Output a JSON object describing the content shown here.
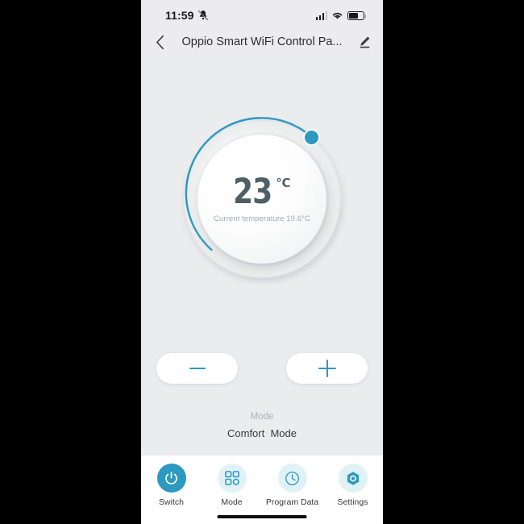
{
  "status_bar": {
    "time": "11:59",
    "mute_icon": "bell-slash-icon",
    "signal_icon": "cellular-signal-icon",
    "wifi_icon": "wifi-icon",
    "battery_icon": "battery-icon",
    "battery_level": 60
  },
  "header": {
    "back_icon": "chevron-left-icon",
    "title": "Oppio Smart WiFi Control Pa...",
    "edit_icon": "pencil-edit-icon"
  },
  "dial": {
    "target_temperature": "23",
    "unit": "℃",
    "current_temperature_text": "Current temperature 19.6°C",
    "arc_value_percent": 72,
    "arc_color": "#2b99c0",
    "track_color": "#e3e4e6",
    "knob_icon": "slider-knob"
  },
  "controls": {
    "decrease_label": "−",
    "decrease_icon": "minus-icon",
    "increase_label": "+",
    "increase_icon": "plus-icon"
  },
  "mode": {
    "label": "Mode",
    "value": "Comfort  Mode"
  },
  "bottom_nav": {
    "items": [
      {
        "label": "Switch",
        "icon": "power-icon",
        "active": true
      },
      {
        "label": "Mode",
        "icon": "grid-squares-icon",
        "active": false
      },
      {
        "label": "Program Data",
        "icon": "clock-icon",
        "active": false
      },
      {
        "label": "Settings",
        "icon": "hex-nut-gear-icon",
        "active": false
      }
    ]
  },
  "colors": {
    "accent": "#2b99c0",
    "accent_soft": "#e1f2f7",
    "background": "#ebecee",
    "text_dark": "#3a3a3a",
    "text_muted": "#a4a9ad"
  }
}
